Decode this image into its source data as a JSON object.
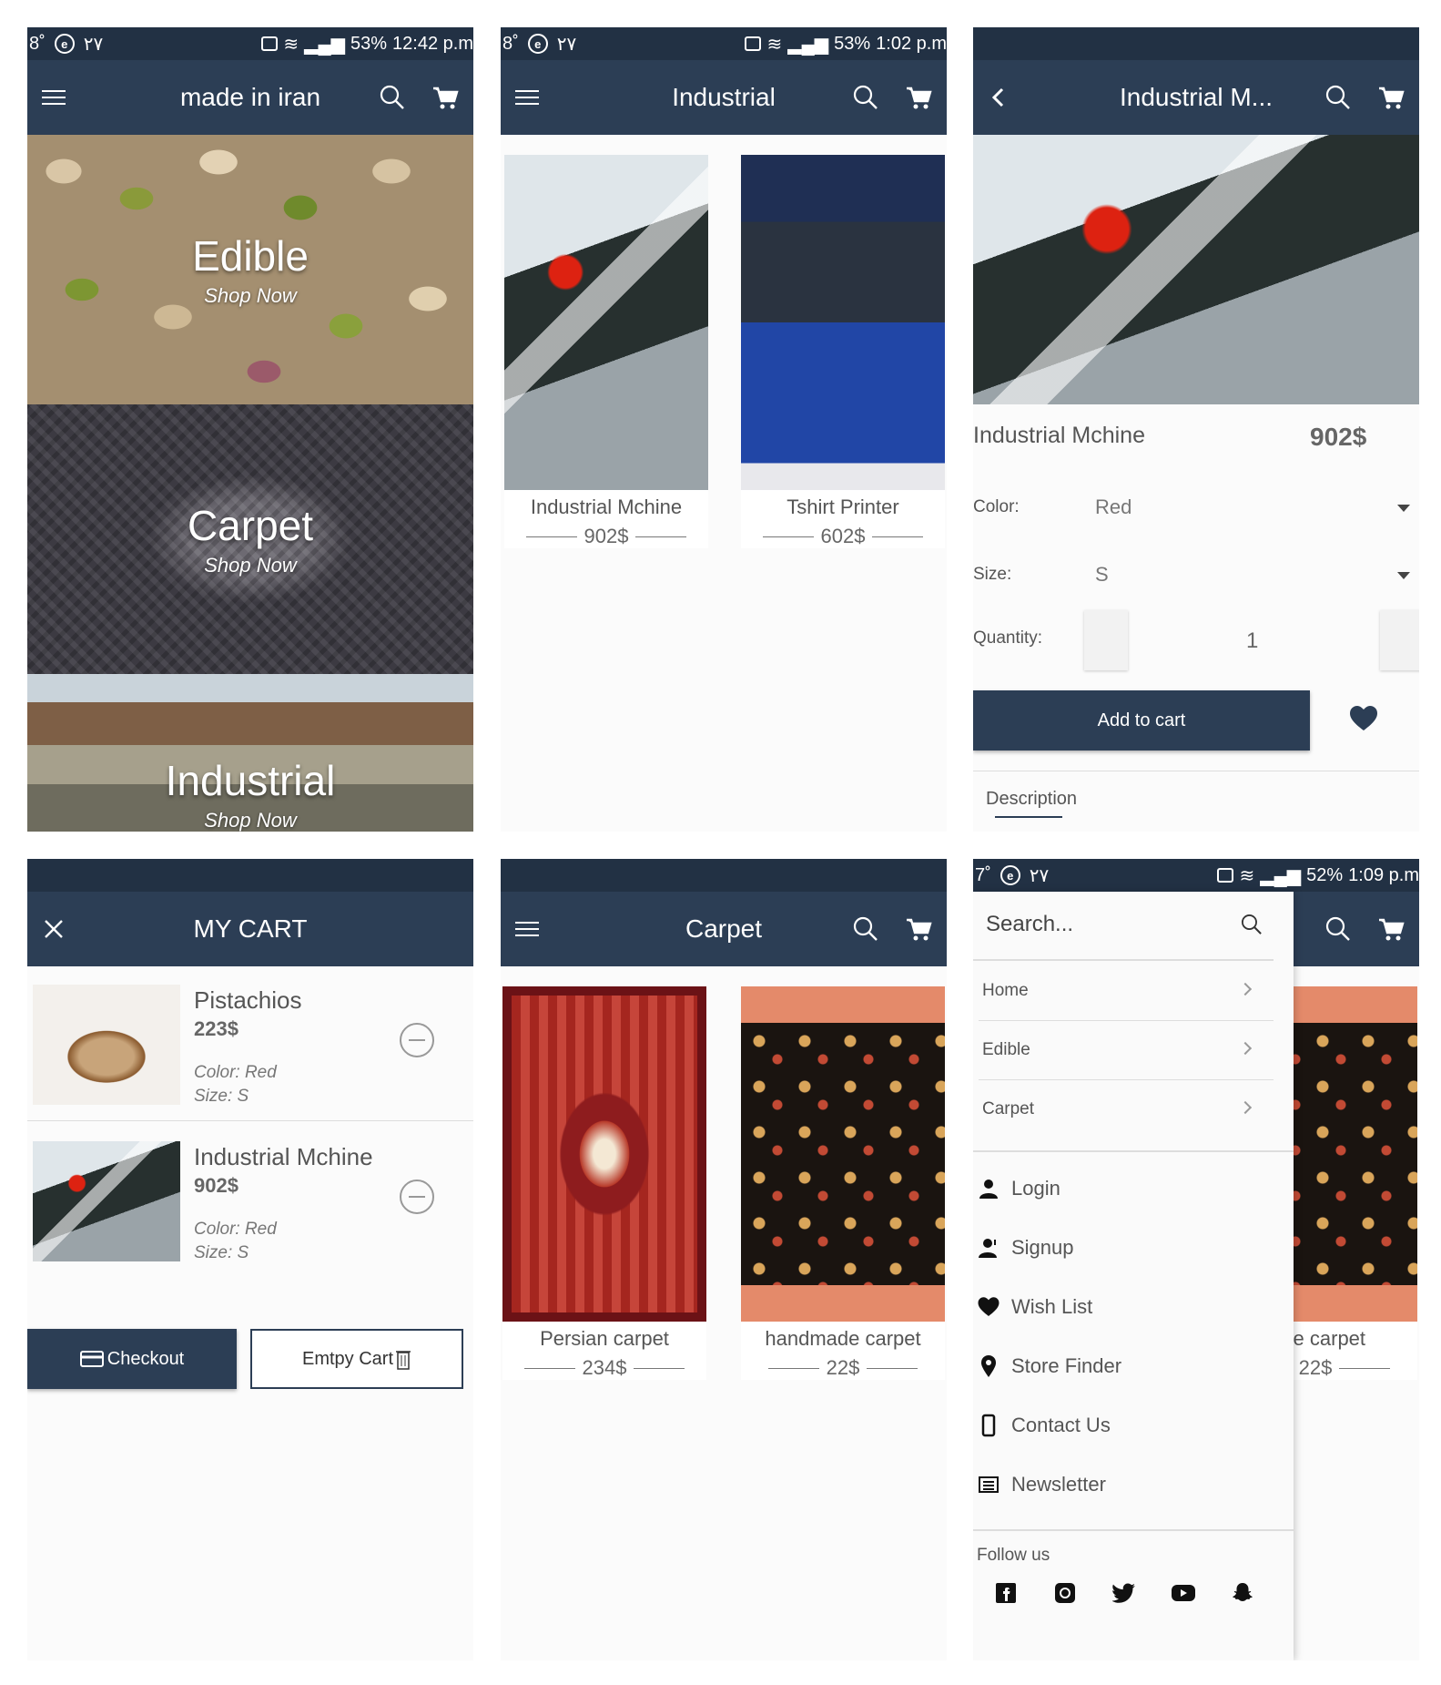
{
  "screens": {
    "home": {
      "status": {
        "left": [
          "8˚",
          "e",
          "۲۷"
        ],
        "battery": "53%",
        "time": "12:42 p.m"
      },
      "title": "made in iran",
      "banners": [
        {
          "title": "Edible",
          "sub": "Shop Now"
        },
        {
          "title": "Carpet",
          "sub": "Shop Now"
        },
        {
          "title": "Industrial",
          "sub": "Shop Now"
        }
      ]
    },
    "industrial": {
      "status": {
        "left": [
          "8˚",
          "e",
          "۲۷"
        ],
        "battery": "53%",
        "time": "1:02 p.m"
      },
      "title": "Industrial",
      "products": [
        {
          "name": "Industrial Mchine",
          "price": "902$"
        },
        {
          "name": "Tshirt Printer",
          "price": "602$"
        }
      ]
    },
    "detail": {
      "title": "Industrial M...",
      "name": "Industrial Mchine",
      "price": "902$",
      "color_label": "Color:",
      "color_value": "Red",
      "size_label": "Size:",
      "size_value": "S",
      "quantity_label": "Quantity:",
      "quantity_value": "1",
      "add_to_cart": "Add to cart",
      "tab_description": "Description"
    },
    "cart": {
      "title": "MY CART",
      "items": [
        {
          "name": "Pistachios",
          "price": "223$",
          "color": "Color: Red",
          "size": "Size: S"
        },
        {
          "name": "Industrial Mchine",
          "price": "902$",
          "color": "Color: Red",
          "size": "Size: S"
        }
      ],
      "checkout": "Checkout",
      "empty_cart": "Emtpy Cart"
    },
    "carpet": {
      "title": "Carpet",
      "products": [
        {
          "name": "Persian carpet",
          "price": "234$"
        },
        {
          "name": "handmade carpet",
          "price": "22$"
        }
      ]
    },
    "menu": {
      "status": {
        "left": [
          "7˚",
          "e",
          "۲۷"
        ],
        "battery": "52%",
        "time": "1:09 p.m"
      },
      "search_placeholder": "Search...",
      "nav": [
        "Home",
        "Edible",
        "Carpet"
      ],
      "items": [
        {
          "label": "Login",
          "icon": "user-icon"
        },
        {
          "label": "Signup",
          "icon": "user-plus-icon"
        },
        {
          "label": "Wish List",
          "icon": "heart-icon"
        },
        {
          "label": "Store Finder",
          "icon": "map-pin-icon"
        },
        {
          "label": "Contact Us",
          "icon": "phone-icon"
        },
        {
          "label": "Newsletter",
          "icon": "newspaper-icon"
        }
      ],
      "follow_us": "Follow us",
      "social": [
        "facebook-icon",
        "instagram-icon",
        "twitter-icon",
        "youtube-icon",
        "snapchat-icon"
      ],
      "peek_product": {
        "name": "ıade carpet",
        "price": "22$"
      }
    }
  },
  "colors": {
    "appbar": "#2c3e55",
    "statusbar": "#223144",
    "background": "#fbfbfb"
  }
}
